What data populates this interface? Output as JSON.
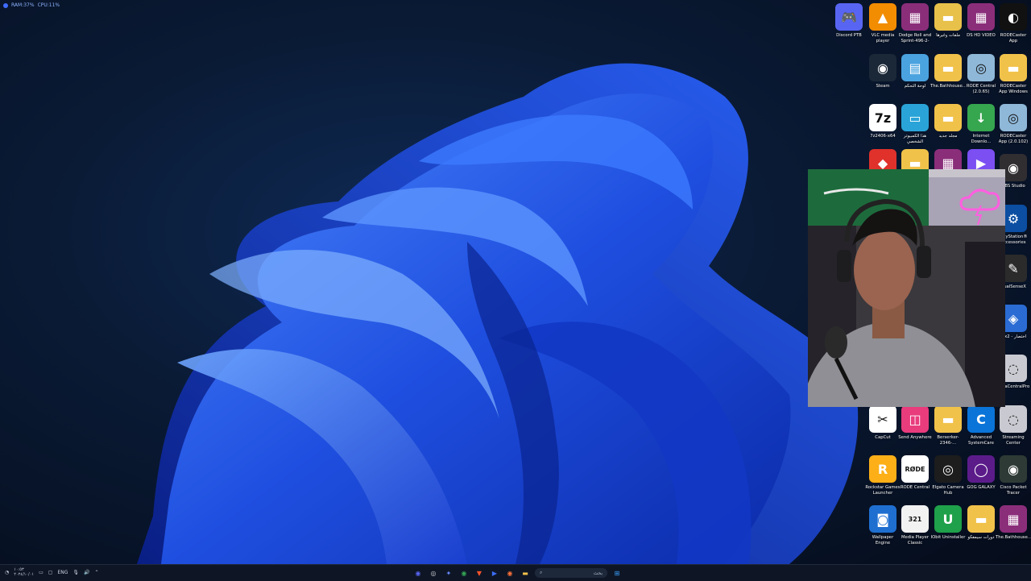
{
  "perf_overlay": {
    "ram": "RAM:37%",
    "cpu": "CPU:11%"
  },
  "desktop_icons": [
    {
      "label": "Discord PTB",
      "glyph": "🎮",
      "bg": "#5865f2"
    },
    {
      "label": "VLC media player",
      "glyph": "▲",
      "bg": "#f28c00"
    },
    {
      "label": "Dodge Roll and Sprint-496-2-30...",
      "glyph": "▦",
      "bg": "#8b2e7a"
    },
    {
      "label": "ملفات وغيرها",
      "glyph": "▬",
      "bg": "#e8c14a"
    },
    {
      "label": "DS HD VIDEO",
      "glyph": "▦",
      "bg": "#8b2e7a"
    },
    {
      "label": "RODECaster App",
      "glyph": "◐",
      "bg": "#111111"
    },
    {
      "label": "Steam",
      "glyph": "◉",
      "bg": "#1b2838"
    },
    {
      "label": "لوحة التحكم",
      "glyph": "▤",
      "bg": "#4aa3df"
    },
    {
      "label": "The.Bathhouse...",
      "glyph": "▬",
      "bg": "#f1c24a"
    },
    {
      "label": "RODE Central (2.0.65)",
      "glyph": "◎",
      "bg": "#8fb8d8"
    },
    {
      "label": "RODECaster App Windows v2.0.102",
      "glyph": "▬",
      "bg": "#f1c24a"
    },
    {
      "label": "7z2406-x64",
      "glyph": "7z",
      "bg": "#ffffff"
    },
    {
      "label": "هذا الكمبيوتر الشخصي",
      "glyph": "▭",
      "bg": "#2aa4d8"
    },
    {
      "label": "مجلد جديد",
      "glyph": "▬",
      "bg": "#f1c24a"
    },
    {
      "label": "Internet Downlo...",
      "glyph": "↓",
      "bg": "#36a64f"
    },
    {
      "label": "RODECaster App (2.0.102)",
      "glyph": "◎",
      "bg": "#8fb8d8"
    },
    {
      "label": "",
      "glyph": "◆",
      "bg": "#e0312b"
    },
    {
      "label": "",
      "glyph": "▬",
      "bg": "#f1c24a"
    },
    {
      "label": "",
      "glyph": "▦",
      "bg": "#8b2e7a"
    },
    {
      "label": "",
      "glyph": "▶",
      "bg": "#7b4ff2"
    },
    {
      "label": "OBS Studio",
      "glyph": "◉",
      "bg": "#302e31"
    },
    {
      "label": "PlayStation® Accessories",
      "glyph": "⚙",
      "bg": "#0b4ea2"
    },
    {
      "label": "DualSenseX",
      "glyph": "✎",
      "bg": "#2b2b2b"
    },
    {
      "label": "2-x2 - اختصار",
      "glyph": "◈",
      "bg": "#2b6cd4"
    },
    {
      "label": "UltraCentralPro",
      "glyph": "◌",
      "bg": "#c9c9d1"
    },
    {
      "label": "CapCut",
      "glyph": "✂",
      "bg": "#ffffff"
    },
    {
      "label": "Send Anywhere",
      "glyph": "◫",
      "bg": "#e93c7d"
    },
    {
      "label": "Berserker-2346-...",
      "glyph": "▬",
      "bg": "#f1c24a"
    },
    {
      "label": "Advanced SystemCare",
      "glyph": "C",
      "bg": "#0a74d9"
    },
    {
      "label": "Streaming Center",
      "glyph": "◌",
      "bg": "#c9c9d1"
    },
    {
      "label": "Rockstar Games Launcher",
      "glyph": "R",
      "bg": "#fcaf17"
    },
    {
      "label": "RODE Central",
      "glyph": "RØDE",
      "bg": "#ffffff"
    },
    {
      "label": "Elgato Camera Hub",
      "glyph": "◎",
      "bg": "#1d1d1d"
    },
    {
      "label": "GOG GALAXY",
      "glyph": "◯",
      "bg": "#5b1c8a"
    },
    {
      "label": "Cisco Packet Tracer",
      "glyph": "◉",
      "bg": "#2e3a35"
    },
    {
      "label": "Wallpaper Engine",
      "glyph": "◙",
      "bg": "#1f6fd1"
    },
    {
      "label": "Media Player Classic",
      "glyph": "321",
      "bg": "#f2f2f2"
    },
    {
      "label": "IObit Uninstaller",
      "glyph": "U",
      "bg": "#1fa04a"
    },
    {
      "label": "دورات سيمفكو",
      "glyph": "▬",
      "bg": "#f1c24a"
    },
    {
      "label": "The.Bathhouse...",
      "glyph": "▦",
      "bg": "#8b2e7a"
    }
  ],
  "taskbar": {
    "lang": "ENG",
    "time": "١٠:٥٣",
    "date": "٢٠٢٤/١٠/٠١",
    "search_placeholder": "بحث",
    "pinned": [
      {
        "name": "discord",
        "glyph": "◉",
        "color": "#5865f2"
      },
      {
        "name": "obs",
        "glyph": "◎",
        "color": "#cccccc"
      },
      {
        "name": "app",
        "glyph": "✦",
        "color": "#6a8bff"
      },
      {
        "name": "chrome",
        "glyph": "◉",
        "color": "#34a853"
      },
      {
        "name": "brave",
        "glyph": "▼",
        "color": "#fb542b"
      },
      {
        "name": "media",
        "glyph": "▶",
        "color": "#3b6df2"
      },
      {
        "name": "firefox",
        "glyph": "◉",
        "color": "#ff7139"
      },
      {
        "name": "file-explorer",
        "glyph": "▬",
        "color": "#f1c24a"
      }
    ]
  }
}
